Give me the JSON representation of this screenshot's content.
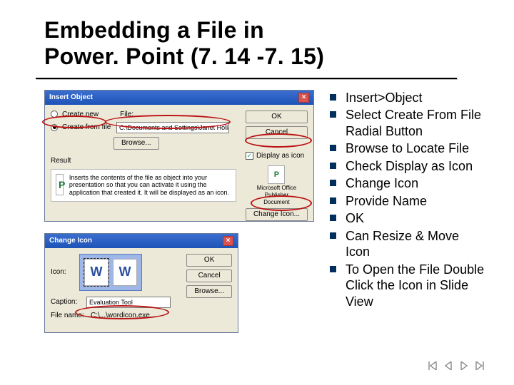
{
  "title_line1": "Embedding a File in",
  "title_line2": "Power. Point (7. 14 -7. 15)",
  "bullets": [
    "Insert>Object",
    "Select Create From File Radial Button",
    "Browse to Locate File",
    "Check Display as Icon",
    "Change Icon",
    "Provide Name",
    "OK",
    "Can Resize & Move Icon",
    "To Open the File Double Click the Icon in Slide View"
  ],
  "dlg1": {
    "title": "Insert Object",
    "create_new": "Create new",
    "create_from_file": "Create from file",
    "file_label": "File:",
    "file_path": "C:\\Documents and Settings\\Janet Holland\\My Documen",
    "browse": "Browse...",
    "display_as_icon": "Display as icon",
    "change_icon": "Change Icon...",
    "ok": "OK",
    "cancel": "Cancel",
    "result_label": "Result",
    "result_text": "Inserts the contents of the file as object into your presentation so that you can activate it using the application that created it. It will be displayed as an icon.",
    "icon_caption1": "Microsoft Office",
    "icon_caption2": "Publisher",
    "icon_caption3": "Document"
  },
  "dlg2": {
    "title": "Change Icon",
    "icon_label": "Icon:",
    "ok": "OK",
    "cancel": "Cancel",
    "browse": "Browse...",
    "caption_label": "Caption:",
    "caption_value": "Evaluation Tool",
    "filename_label": "File name:",
    "filename_value": "C:\\...\\wordicon.exe"
  }
}
